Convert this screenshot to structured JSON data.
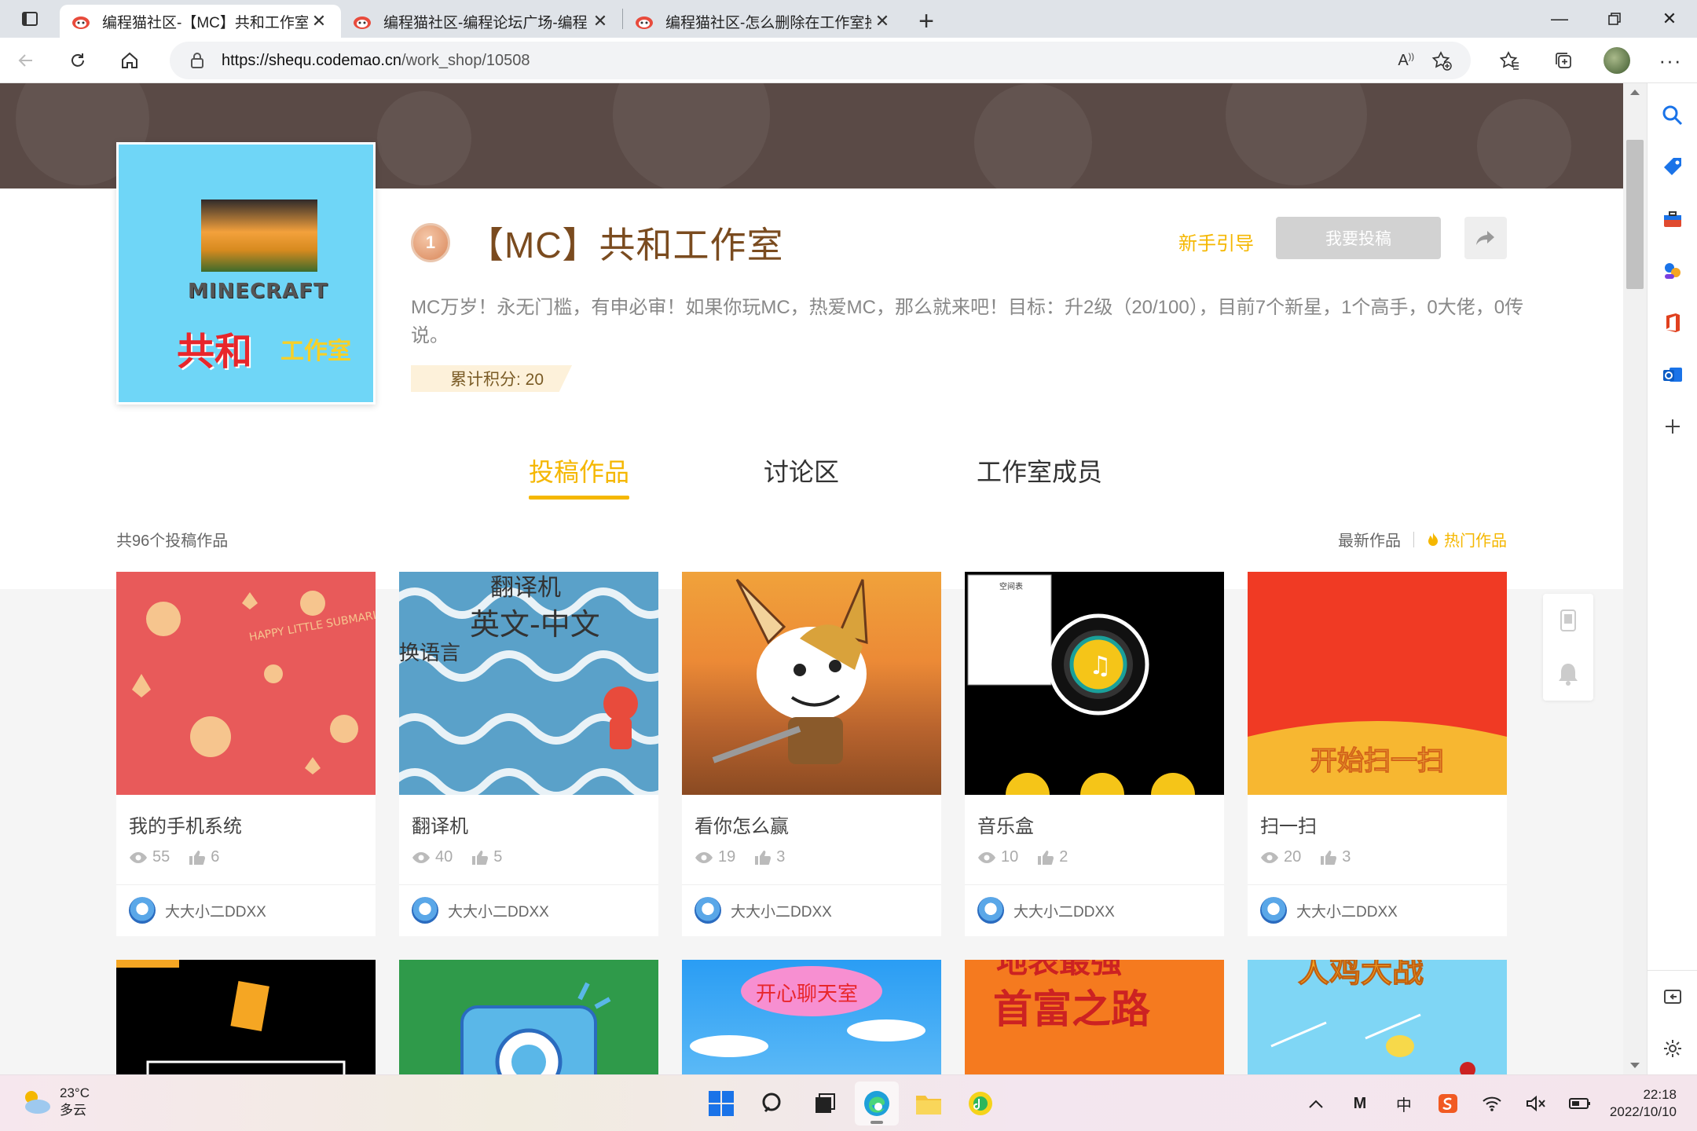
{
  "browser": {
    "tabs": [
      {
        "title": "编程猫社区-【MC】共和工作室-",
        "active": true
      },
      {
        "title": "编程猫社区-编程论坛广场-编程"
      },
      {
        "title": "编程猫社区-怎么删除在工作室投"
      }
    ],
    "url_host": "https://shequ.codemao.cn",
    "url_path": "/work_shop/10508"
  },
  "workshop": {
    "title": "【MC】共和工作室",
    "level": "1",
    "description": "MC万岁！永无门槛，有申必审！如果你玩MC，热爱MC，那么就来吧！目标：升2级（20/100），目前7个新星，1个高手，0大佬，0传说。",
    "score_label": "累计积分: 20",
    "guide_label": "新手引导",
    "submit_label": "我要投稿",
    "cover_text": {
      "mc": "MINECRAFT",
      "gh": "共和",
      "gzs": "工作室"
    }
  },
  "tabs": [
    "投稿作品",
    "讨论区",
    "工作室成员"
  ],
  "list": {
    "count_label": "共96个投稿作品",
    "sort_new": "最新作品",
    "sort_hot": "热门作品"
  },
  "works": [
    {
      "title": "我的手机系统",
      "views": "55",
      "likes": "6",
      "author": "大大小二DDXX"
    },
    {
      "title": "翻译机",
      "views": "40",
      "likes": "5",
      "author": "大大小二DDXX"
    },
    {
      "title": "看你怎么赢",
      "views": "19",
      "likes": "3",
      "author": "大大小二DDXX"
    },
    {
      "title": "音乐盒",
      "views": "10",
      "likes": "2",
      "author": "大大小二DDXX"
    },
    {
      "title": "扫一扫",
      "views": "20",
      "likes": "3",
      "author": "大大小二DDXX"
    }
  ],
  "thumb_text": {
    "happy": "HAPPY LITTLE SUBMARINE",
    "fy1": "翻译机",
    "fy2": "英文-中文",
    "fy3": "换语言",
    "ts_label": "空间表",
    "scan": "开始扫一扫",
    "chat": "开心聊天室",
    "rich": "首富之路",
    "richtop": "地表最强",
    "fight": "人鸡大战"
  },
  "taskbar": {
    "temp": "23°C",
    "weather": "多云",
    "time": "22:18",
    "date": "2022/10/10",
    "ime": "中"
  },
  "colors": {
    "accent": "#f5b700",
    "banner": "#5a4a46",
    "title": "#7a4b1f"
  }
}
